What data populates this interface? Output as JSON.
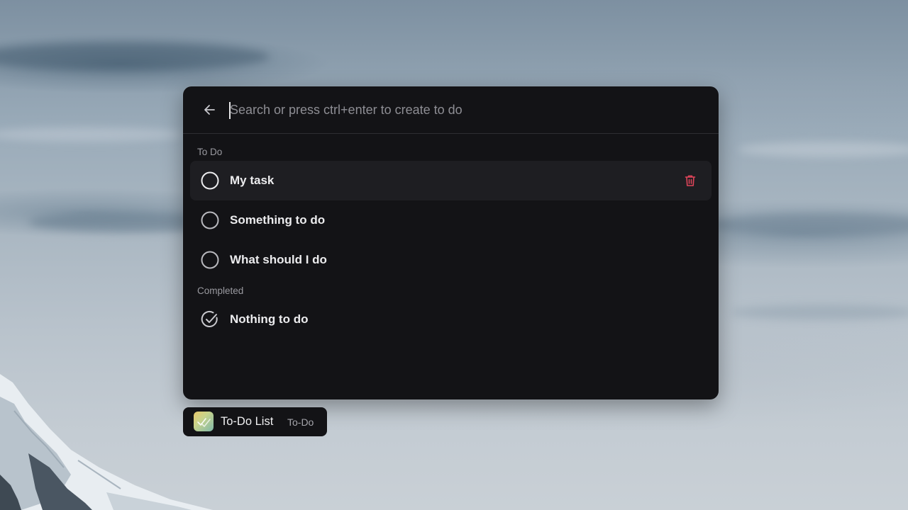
{
  "search": {
    "placeholder": "Search or press ctrl+enter to create to do",
    "value": ""
  },
  "sections": {
    "todo_label": "To Do",
    "completed_label": "Completed"
  },
  "todo_items": [
    {
      "label": "My task",
      "checked": false,
      "hovered": true
    },
    {
      "label": "Something to do",
      "checked": false,
      "hovered": false
    },
    {
      "label": "What should I do",
      "checked": false,
      "hovered": false
    }
  ],
  "completed_items": [
    {
      "label": "Nothing to do",
      "checked": true
    }
  ],
  "taskbar": {
    "app_name": "To-Do List",
    "app_subtitle": "To-Do"
  },
  "icons": {
    "back": "arrow-left-icon",
    "unchecked": "circle-icon",
    "checked": "check-circle-icon",
    "delete": "trash-icon",
    "app": "todo-app-icon"
  },
  "colors": {
    "panel_bg": "#131316",
    "row_hover_bg": "#1e1e22",
    "delete_accent": "#e0455a",
    "text_primary": "#ececee",
    "text_muted": "#9a9aa0"
  }
}
